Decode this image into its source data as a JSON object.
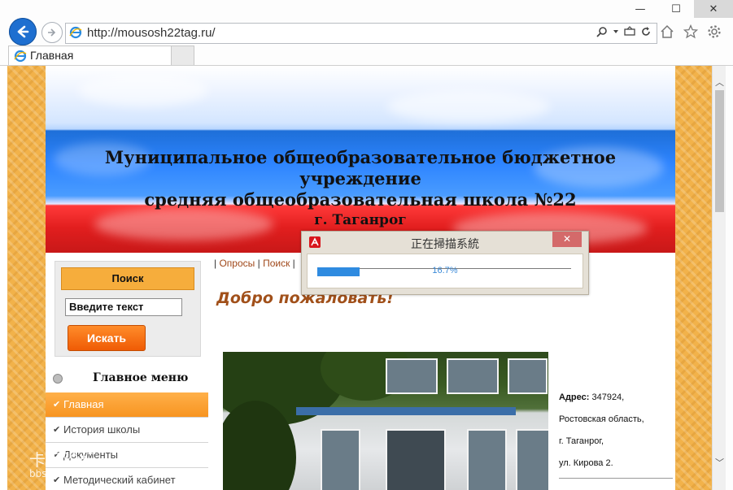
{
  "browser": {
    "url": "http://mousosh22tag.ru/",
    "tab_title": "Главная",
    "tab_close": "×",
    "win_min": "—",
    "win_max": "☐",
    "win_close": "✕"
  },
  "banner": {
    "title_line1": "Муниципальное общеобразовательное бюджетное учреждение",
    "title_line2": "средняя общеобразовательная школа №22",
    "city": "г. Таганрог"
  },
  "search": {
    "title": "Поиск",
    "input_value": "Введите текст",
    "button_label": "Искать"
  },
  "menu": {
    "header": "Главное меню",
    "items": [
      {
        "label": "Главная",
        "active": true
      },
      {
        "label": "История школы",
        "active": false
      },
      {
        "label": "Документы",
        "active": false
      },
      {
        "label": "Методический кабинет",
        "active": false
      }
    ]
  },
  "toplinks": {
    "links": [
      "Опросы",
      "Поиск"
    ]
  },
  "welcome": "Добро пожаловать!",
  "address": {
    "label": "Адрес:",
    "line1": "347924,",
    "line2": "Ростовская область,",
    "line3": "г. Таганрог,",
    "line4": "ул. Кирова 2."
  },
  "scan_dialog": {
    "title": "正在掃描系統",
    "progress_text": "16.7%",
    "progress_fraction": 0.167,
    "close": "✕"
  },
  "watermark": {
    "line1": "卡饭论坛",
    "line2": "bbs.kafan.cn"
  }
}
